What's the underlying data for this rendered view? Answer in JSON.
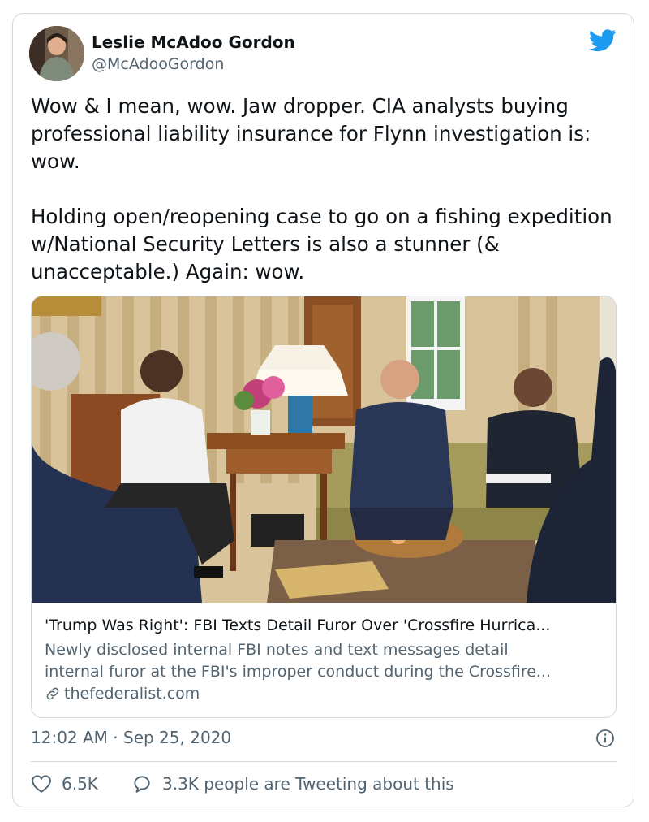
{
  "author": {
    "name": "Leslie McAdoo Gordon",
    "handle": "@McAdooGordon"
  },
  "tweet": {
    "text": "Wow & I mean, wow. Jaw dropper. CIA analysts buying professional liability insurance for Flynn investigation is: wow.\n\nHolding open/reopening case to go on a fishing expedition w/National Security Letters is also a stunner (& unacceptable.) Again: wow."
  },
  "link_card": {
    "title": "'Trump Was Right': FBI Texts Detail Furor Over 'Crossfire Hurrica...",
    "description_line1": "Newly disclosed internal FBI notes and text messages detail",
    "description_line2": "internal furor at the FBI's improper conduct during the Crossfire...",
    "domain": "thefederalist.com"
  },
  "meta": {
    "timestamp": "12:02 AM · Sep 25, 2020"
  },
  "actions": {
    "likes": "6.5K",
    "tweeting": "3.3K people are Tweeting about this"
  },
  "icons": {
    "brand": "twitter-bird-icon",
    "info": "info-icon",
    "link": "link-icon",
    "like": "heart-icon",
    "reply": "speech-bubble-icon"
  },
  "colors": {
    "brand_blue": "#1d9bf0",
    "secondary_text": "#536471",
    "border": "#cfd9de"
  }
}
